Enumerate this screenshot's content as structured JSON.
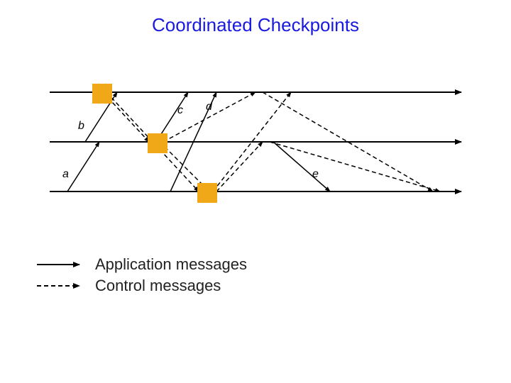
{
  "title": "Coordinated Checkpoints",
  "legend": {
    "solid": "Application messages",
    "dashed": "Control messages"
  },
  "labels": {
    "a": "a",
    "b": "b",
    "c": "c",
    "d": "d",
    "e": "e"
  },
  "colors": {
    "title": "#1a1adf",
    "checkpoint_fill": "#f0a818",
    "line": "#000000"
  }
}
